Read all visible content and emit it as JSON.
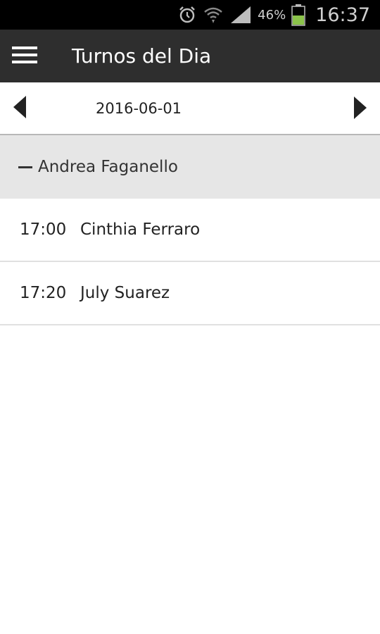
{
  "status_bar": {
    "battery_text": "46%",
    "clock": "16:37",
    "icons": [
      "alarm-icon",
      "wifi-icon",
      "signal-icon",
      "battery-icon"
    ],
    "battery_color": "#8bc34a"
  },
  "action_bar": {
    "title": "Turnos del Dia",
    "background": "#2e2e2e"
  },
  "date_nav": {
    "date": "2016-06-01"
  },
  "group": {
    "name": "Andrea Faganello",
    "background": "#e6e6e6"
  },
  "appointments": [
    {
      "time": "17:00",
      "name": "Cinthia Ferraro"
    },
    {
      "time": "17:20",
      "name": "July Suarez"
    }
  ]
}
